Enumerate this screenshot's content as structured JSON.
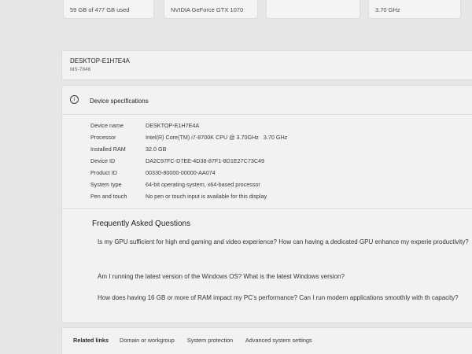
{
  "summary_tiles": [
    {
      "text": "59 GB of 477 GB used"
    },
    {
      "text": "NVIDIA GeForce GTX 1070"
    },
    {
      "text": ""
    },
    {
      "text": "3.70 GHz"
    }
  ],
  "device_header": {
    "name": "DESKTOP-E1H7E4A",
    "model": "MS-7846"
  },
  "specs": {
    "title": "Device specifications",
    "icon": "info-icon",
    "rows": [
      {
        "label": "Device name",
        "value": "DESKTOP-E1H7E4A"
      },
      {
        "label": "Processor",
        "value": "Intel(R) Core(TM) i7-8700K CPU @ 3.70GHz   3.70 GHz"
      },
      {
        "label": "Installed RAM",
        "value": "32.0 GB"
      },
      {
        "label": "Device ID",
        "value": "DA2C97FC-D7EE-4D38-87F1-8D1E27C73C49"
      },
      {
        "label": "Product ID",
        "value": "00330-80000-00000-AA074"
      },
      {
        "label": "System type",
        "value": "64-bit operating system, x64-based processor"
      },
      {
        "label": "Pen and touch",
        "value": "No pen or touch input is available for this display"
      }
    ]
  },
  "faq": {
    "title": "Frequently Asked Questions",
    "questions": [
      {
        "text": "Is my GPU sufficient for high end gaming and video experience? How can having a dedicated GPU enhance my experie productivity?"
      },
      {
        "text": "Am I running the latest version of the Windows OS? What is the latest Windows version?"
      },
      {
        "text": "How does having 16 GB or more of RAM impact my PC's performance? Can I run modern applications smoothly with th capacity?"
      }
    ]
  },
  "related_links": {
    "label": "Related links",
    "links": [
      {
        "label": "Domain or workgroup"
      },
      {
        "label": "System protection"
      },
      {
        "label": "Advanced system settings"
      }
    ]
  }
}
